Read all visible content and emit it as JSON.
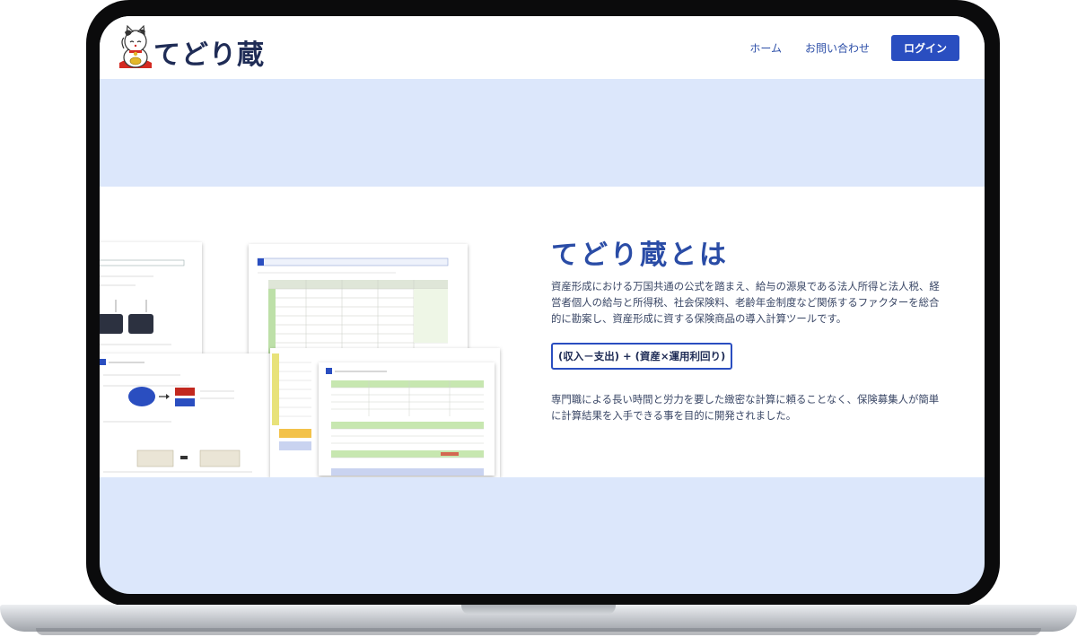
{
  "header": {
    "logo_text": "てどり蔵",
    "nav": {
      "home": "ホーム",
      "contact": "お問い合わせ",
      "login": "ログイン"
    }
  },
  "about": {
    "title": "てどり蔵とは",
    "description": "資産形成における万国共通の公式を踏まえ、給与の源泉である法人所得と法人税、経営者個人の給与と所得税、社会保険料、老齢年金制度など関係するファクターを総合的に勘案し、資産形成に資する保険商品の導入計算ツールです。",
    "formula": "(収入－支出) + (資産×運用利回り)",
    "purpose": "専門職による長い時間と労力を要した緻密な計算に頼ることなく、保険募集人が簡単に計算結果を入手できる事を目的に開発されました。"
  },
  "colors": {
    "accent": "#2a4ec0",
    "hero_bg": "#dce7fb",
    "heading": "#2a4ca6"
  },
  "icons": [
    "maneki-neko-logo-icon"
  ]
}
